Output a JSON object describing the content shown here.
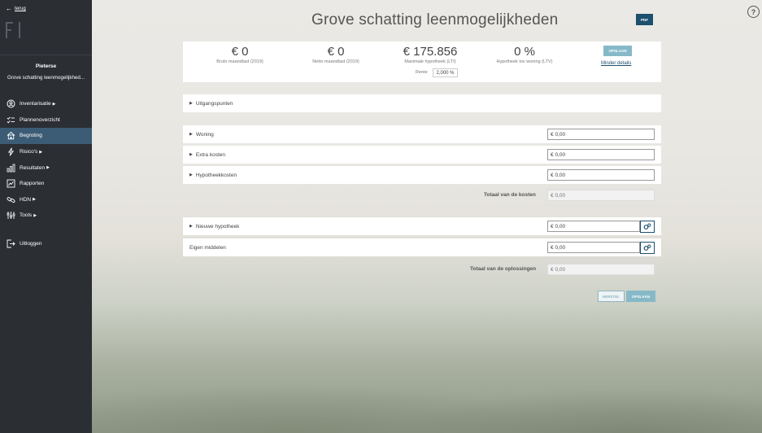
{
  "sidebar": {
    "back_label": "terug",
    "client_name": "Pieterse",
    "client_subtitle": "Grove schatting leenmogelijkhed...",
    "nav": [
      {
        "label": "Inventarisatie",
        "icon": "search-icon",
        "has_caret": true
      },
      {
        "label": "Plannenoverzicht",
        "icon": "checklist-icon",
        "has_caret": false
      },
      {
        "label": "Begroting",
        "icon": "house-icon",
        "has_caret": false,
        "active": true
      },
      {
        "label": "Risico's",
        "icon": "lightning-icon",
        "has_caret": true
      },
      {
        "label": "Resultaten",
        "icon": "bar-chart-icon",
        "has_caret": true
      },
      {
        "label": "Rapporten",
        "icon": "report-icon",
        "has_caret": false
      },
      {
        "label": "HDN",
        "icon": "link-icon",
        "has_caret": true
      },
      {
        "label": "Tools",
        "icon": "tools-icon",
        "has_caret": true
      }
    ],
    "logout_label": "Uitloggen"
  },
  "header": {
    "title": "Grove schatting leenmogelijkheden",
    "pdf_label": "PDF"
  },
  "summary": {
    "bruto": {
      "value": "€ 0",
      "label": "Bruto maandlast (2019)"
    },
    "netto": {
      "value": "€ 0",
      "label": "Netto maandlast (2019)"
    },
    "max_hypotheek": {
      "value": "€ 175.856",
      "label": "Maximale hypotheek (LTI)"
    },
    "ltv": {
      "value": "0 %",
      "label": "Hypotheek tov woning (LTV)"
    },
    "rente_label": "Rente",
    "rente_value": "2,000 %",
    "save_label": "OPSLAAN",
    "less_details_label": "Minder details"
  },
  "sections": {
    "uitgangspunten": "Uitgangspunten",
    "woning": {
      "label": "Woning",
      "value": "0,00"
    },
    "extra_kosten": {
      "label": "Extra kosten",
      "value": "0,00"
    },
    "hypotheekkosten": {
      "label": "Hypotheekkosten",
      "value": "0,00"
    },
    "totaal_kosten": {
      "label": "Totaal van de kosten",
      "value": "0,00"
    },
    "nieuwe_hypotheek": {
      "label": "Nieuwe hypotheek",
      "value": "0,00"
    },
    "eigen_middelen": {
      "label": "Eigen middelen",
      "value": "0,00"
    },
    "totaal_oplossingen": {
      "label": "Totaal van de oplossingen",
      "value": "0,00"
    }
  },
  "currency_symbol": "€",
  "footer": {
    "reset_label": "HERSTEL",
    "save_label": "OPSLAAN"
  },
  "colors": {
    "sidebar_bg": "#2b2e33",
    "active_nav": "#3c5b74",
    "primary_dark": "#1d4f6e",
    "primary_light": "#86b9c8"
  }
}
